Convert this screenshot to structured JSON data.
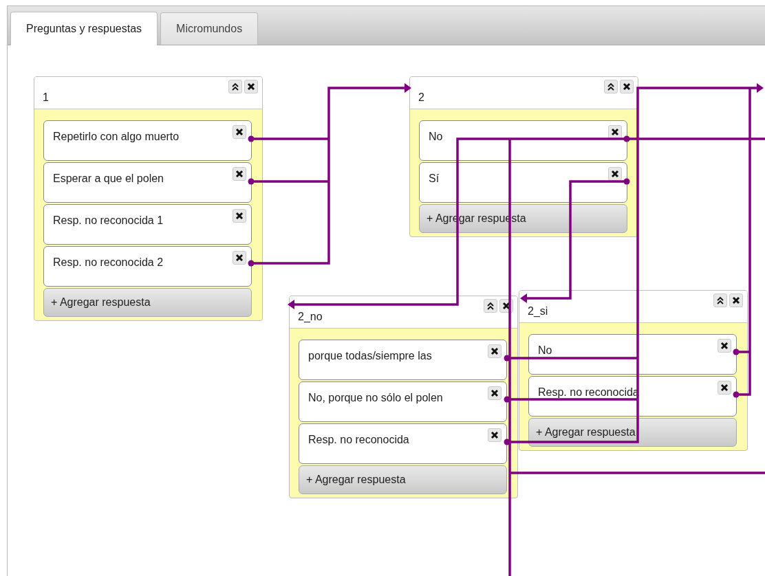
{
  "tabs": [
    {
      "label": "Preguntas y respuestas",
      "selected": true
    },
    {
      "label": "Micromundos",
      "selected": false
    }
  ],
  "nodes": [
    {
      "title": "1",
      "answers": [
        "Repetirlo con algo muerto",
        "Esperar a que el polen",
        "Resp. no reconocida 1",
        "Resp. no reconocida 2"
      ],
      "add_label": "+ Agregar respuesta"
    },
    {
      "title": "2",
      "answers": [
        "No",
        "Sí"
      ],
      "add_label": "+ Agregar respuesta"
    },
    {
      "title": "2_no",
      "answers": [
        "porque todas/siempre las",
        "No, porque no sólo el polen",
        "Resp. no reconocida"
      ],
      "add_label": "+ Agregar respuesta"
    },
    {
      "title": "2_si",
      "answers": [
        "No",
        "Resp. no reconocida"
      ],
      "add_label": "+ Agregar respuesta"
    }
  ]
}
